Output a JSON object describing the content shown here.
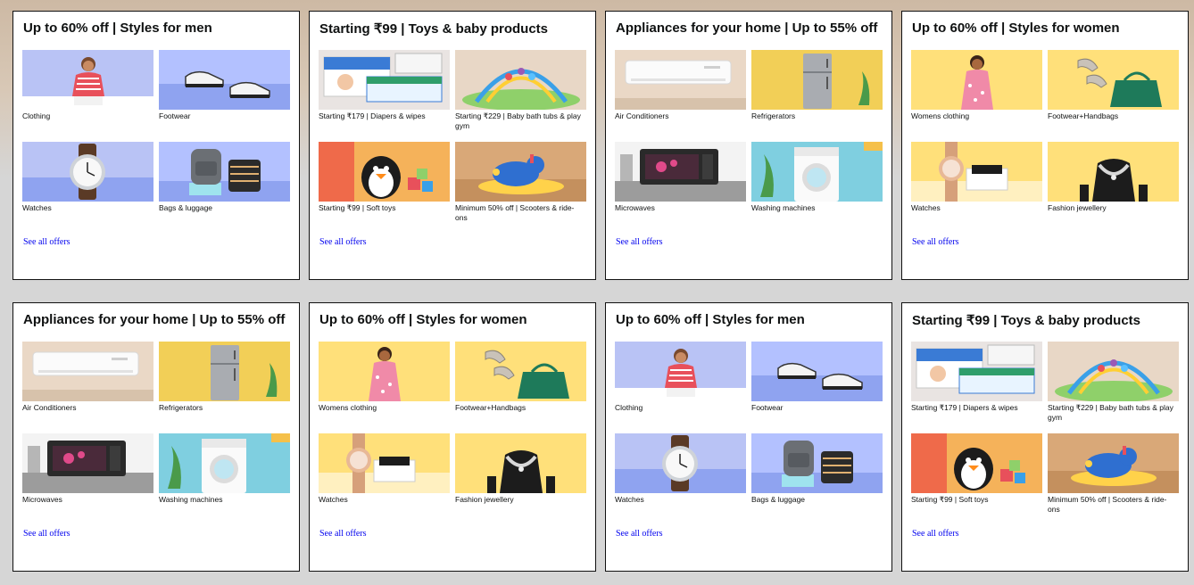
{
  "colors": {
    "background": "#d6d6d6",
    "card": "#ffffff",
    "link": "#0000ee"
  },
  "see_all_label": "See all offers",
  "cards": [
    {
      "title": "Up to 60% off | Styles for men",
      "tiles": [
        {
          "label": "Clothing",
          "icon": "man-clothing-image"
        },
        {
          "label": "Footwear",
          "icon": "sneakers-image"
        },
        {
          "label": "Watches",
          "icon": "watch-image"
        },
        {
          "label": "Bags & luggage",
          "icon": "backpack-image"
        }
      ]
    },
    {
      "title": "Starting ₹99 | Toys & baby products",
      "tiles": [
        {
          "label": "Starting ₹179 | Diapers & wipes",
          "icon": "diapers-image"
        },
        {
          "label": "Starting ₹229 | Baby bath tubs & play gym",
          "icon": "play-gym-image"
        },
        {
          "label": "Starting ₹99 | Soft toys",
          "icon": "penguin-toy-image"
        },
        {
          "label": "Minimum 50% off | Scooters & ride-ons",
          "icon": "ride-on-image"
        }
      ]
    },
    {
      "title": "Appliances for your home | Up to 55% off",
      "tiles": [
        {
          "label": "Air Conditioners",
          "icon": "air-conditioner-image"
        },
        {
          "label": "Refrigerators",
          "icon": "refrigerator-image"
        },
        {
          "label": "Microwaves",
          "icon": "microwave-image"
        },
        {
          "label": "Washing machines",
          "icon": "washing-machine-image"
        }
      ]
    },
    {
      "title": "Up to 60% off | Styles for women",
      "tiles": [
        {
          "label": "Womens clothing",
          "icon": "woman-clothing-image"
        },
        {
          "label": "Footwear+Handbags",
          "icon": "shoes-handbag-image"
        },
        {
          "label": "Watches",
          "icon": "womens-watch-image"
        },
        {
          "label": "Fashion jewellery",
          "icon": "necklace-image"
        }
      ]
    },
    {
      "title": "Appliances for your home | Up to 55% off",
      "tiles": [
        {
          "label": "Air Conditioners",
          "icon": "air-conditioner-image"
        },
        {
          "label": "Refrigerators",
          "icon": "refrigerator-image"
        },
        {
          "label": "Microwaves",
          "icon": "microwave-image"
        },
        {
          "label": "Washing machines",
          "icon": "washing-machine-image"
        }
      ]
    },
    {
      "title": "Up to 60% off | Styles for women",
      "tiles": [
        {
          "label": "Womens clothing",
          "icon": "woman-clothing-image"
        },
        {
          "label": "Footwear+Handbags",
          "icon": "shoes-handbag-image"
        },
        {
          "label": "Watches",
          "icon": "womens-watch-image"
        },
        {
          "label": "Fashion jewellery",
          "icon": "necklace-image"
        }
      ]
    },
    {
      "title": "Up to 60% off | Styles for men",
      "tiles": [
        {
          "label": "Clothing",
          "icon": "man-clothing-image"
        },
        {
          "label": "Footwear",
          "icon": "sneakers-image"
        },
        {
          "label": "Watches",
          "icon": "watch-image"
        },
        {
          "label": "Bags & luggage",
          "icon": "backpack-image"
        }
      ]
    },
    {
      "title": "Starting ₹99 | Toys & baby products",
      "tiles": [
        {
          "label": "Starting ₹179 | Diapers & wipes",
          "icon": "diapers-image"
        },
        {
          "label": "Starting ₹229 | Baby bath tubs & play gym",
          "icon": "play-gym-image"
        },
        {
          "label": "Starting ₹99 | Soft toys",
          "icon": "penguin-toy-image"
        },
        {
          "label": "Minimum 50% off | Scooters & ride-ons",
          "icon": "ride-on-image"
        }
      ]
    }
  ]
}
